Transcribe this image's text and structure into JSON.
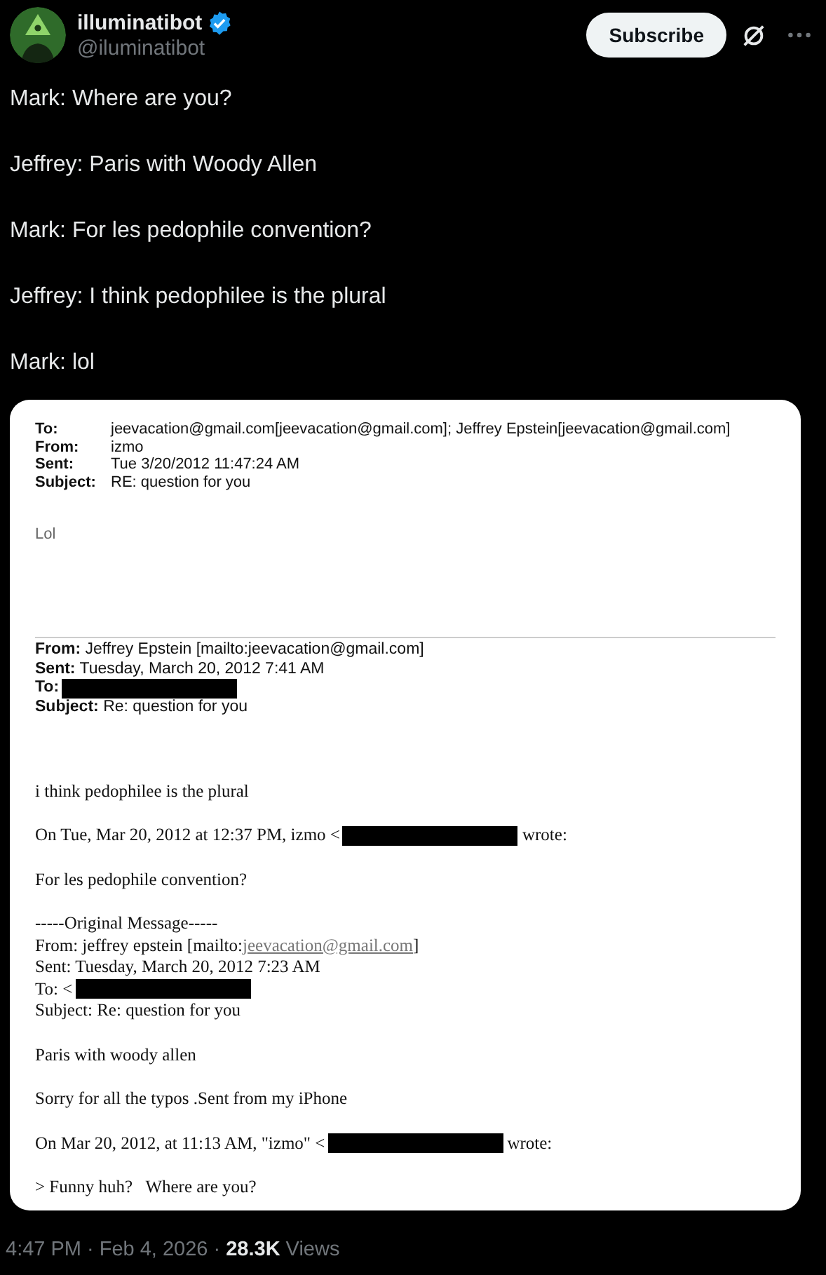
{
  "author": {
    "name": "illuminatibot",
    "handle": "@iluminatibot",
    "verified": true
  },
  "subscribe_button": "Subscribe",
  "tweet_lines": [
    "Mark: Where are you?",
    "Jeffrey: Paris with Woody Allen",
    "Mark: For les pedophile convention?",
    "Jeffrey: I think pedophilee is the plural",
    "Mark: lol"
  ],
  "document": {
    "header": [
      {
        "label": "To:",
        "value": "jeevacation@gmail.com[jeevacation@gmail.com]; Jeffrey Epstein[jeevacation@gmail.com]"
      },
      {
        "label": "From:",
        "value": "izmo"
      },
      {
        "label": "Sent:",
        "value": "Tue 3/20/2012 11:47:24 AM"
      },
      {
        "label": "Subject:",
        "value": "RE: question for you"
      }
    ],
    "note": "Lol",
    "paragraphs": [
      {
        "kind": "sans",
        "lines": [
          [
            {
              "kind": "text",
              "text": "**From:** Jeffrey Epstein [mailto:jeevacation@gmail.com]"
            }
          ],
          [
            {
              "kind": "text",
              "text": "**Sent:** Tuesday, March 20, 2012 7:41 AM"
            }
          ],
          [
            {
              "kind": "text",
              "text": "**To:**"
            },
            {
              "kind": "redacted"
            }
          ],
          [
            {
              "kind": "text",
              "text": "**Subject:** Re: question for you"
            }
          ]
        ]
      },
      {
        "kind": "serif",
        "lines": [
          [
            {
              "kind": "text",
              "text": "i think pedophilee is the plural"
            }
          ]
        ]
      },
      {
        "kind": "serif",
        "lines": [
          [
            {
              "kind": "text",
              "text": "On Tue, Mar 20, 2012 at 12:37 PM, izmo <"
            },
            {
              "kind": "redacted"
            },
            {
              "kind": "text",
              "text": "wrote:"
            }
          ]
        ]
      },
      {
        "kind": "serif",
        "lines": [
          [
            {
              "kind": "text",
              "text": "For les pedophile convention?"
            }
          ]
        ]
      },
      {
        "kind": "serif",
        "lines": [
          [
            {
              "kind": "text",
              "text": "-----Original Message-----"
            }
          ],
          [
            {
              "kind": "text",
              "text": "From: jeffrey epstein [mailto:"
            },
            {
              "kind": "link",
              "text": "jeevacation@gmail.com"
            },
            {
              "kind": "text",
              "text": "]"
            }
          ],
          [
            {
              "kind": "text",
              "text": "Sent: Tuesday, March 20, 2012 7:23 AM"
            }
          ],
          [
            {
              "kind": "text",
              "text": "To: <"
            },
            {
              "kind": "redacted"
            }
          ],
          [
            {
              "kind": "text",
              "text": "Subject: Re: question for you"
            }
          ]
        ]
      },
      {
        "kind": "serif",
        "lines": [
          [
            {
              "kind": "text",
              "text": "Paris with woody allen"
            }
          ]
        ]
      },
      {
        "kind": "serif",
        "lines": [
          [
            {
              "kind": "text",
              "text": "Sorry for all the typos .Sent from my iPhone"
            }
          ]
        ]
      },
      {
        "kind": "serif",
        "lines": [
          [
            {
              "kind": "text",
              "text": "On Mar 20, 2012, at 11:13 AM, \"izmo\" <"
            },
            {
              "kind": "redacted"
            },
            {
              "kind": "text",
              "text": "wrote:"
            }
          ]
        ]
      },
      {
        "kind": "serif",
        "lines": [
          [
            {
              "kind": "text",
              "text": "> Funny huh?   Where are you?"
            }
          ]
        ]
      }
    ]
  },
  "footer": {
    "time": "4:47 PM",
    "separators": [
      "·",
      "·"
    ],
    "date": "Feb 4, 2026",
    "views_count": "28.3K",
    "views_label": "Views"
  }
}
